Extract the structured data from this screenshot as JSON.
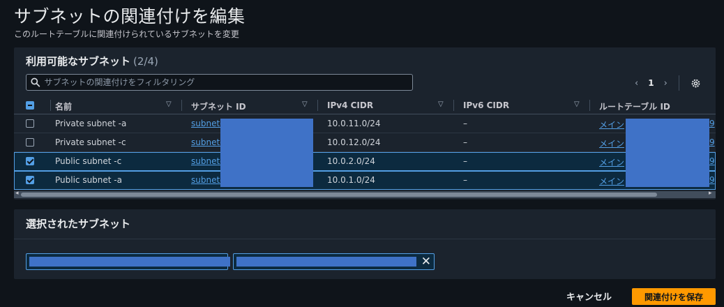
{
  "page": {
    "title": "サブネットの関連付けを編集",
    "subtitle": "このルートテーブルに関連付けられているサブネットを変更"
  },
  "available": {
    "heading": "利用可能なサブネット",
    "count": "(2/4)",
    "filter_placeholder": "サブネットの関連付けをフィルタリング",
    "page_number": "1",
    "columns": [
      "名前",
      "サブネット ID",
      "IPv4 CIDR",
      "IPv6 CIDR",
      "ルートテーブル ID"
    ],
    "rows": [
      {
        "name": "Private subnet -a",
        "subnet_id": "subnet-",
        "ipv4": "10.0.11.0/24",
        "ipv6": "–",
        "route_table": "メイン",
        "route_suffix": "9",
        "checked": false
      },
      {
        "name": "Private subnet -c",
        "subnet_id": "subnet-",
        "ipv4": "10.0.12.0/24",
        "ipv6": "–",
        "route_table": "メイン",
        "route_suffix": "9",
        "checked": false
      },
      {
        "name": "Public subnet -c",
        "subnet_id": "subnet-",
        "ipv4": "10.0.2.0/24",
        "ipv6": "–",
        "route_table": "メイン",
        "route_suffix": "9",
        "checked": true
      },
      {
        "name": "Public subnet -a",
        "subnet_id": "subnet-",
        "ipv4": "10.0.1.0/24",
        "ipv6": "–",
        "route_table": "メイン",
        "route_suffix": "9",
        "checked": true
      }
    ]
  },
  "selected": {
    "heading": "選択されたサブネット"
  },
  "footer": {
    "cancel_label": "キャンセル",
    "save_label": "関連付けを保存"
  },
  "colors": {
    "accent": "#539fe5",
    "primary_button": "#ff9900",
    "redaction": "#3f72c7"
  }
}
